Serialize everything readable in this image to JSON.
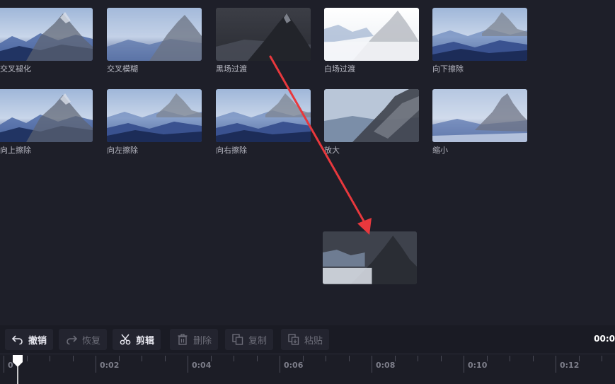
{
  "transitions": [
    {
      "label": "交叉褪化",
      "style": "fade"
    },
    {
      "label": "交叉模糊",
      "style": "blur"
    },
    {
      "label": "黑场过渡",
      "style": "black"
    },
    {
      "label": "白场过渡",
      "style": "white"
    },
    {
      "label": "向下擦除",
      "style": "blue"
    },
    {
      "label": "向上擦除",
      "style": "fade"
    },
    {
      "label": "向左擦除",
      "style": "blue"
    },
    {
      "label": "向右擦除",
      "style": "blue"
    },
    {
      "label": "放大",
      "style": "zoom"
    },
    {
      "label": "缩小",
      "style": "shrink"
    }
  ],
  "toolbar": {
    "undo": "撤销",
    "redo": "恢复",
    "cut": "剪辑",
    "delete": "删除",
    "copy": "复制",
    "paste": "粘贴",
    "time": "00:0"
  },
  "timeline": {
    "labels": [
      "0:02",
      "0:04",
      "0:06",
      "0:08",
      "0:10",
      "0:12"
    ],
    "playhead_label": "0"
  },
  "colors": {
    "background": "#1e1f29",
    "arrow": "#e8383d"
  }
}
